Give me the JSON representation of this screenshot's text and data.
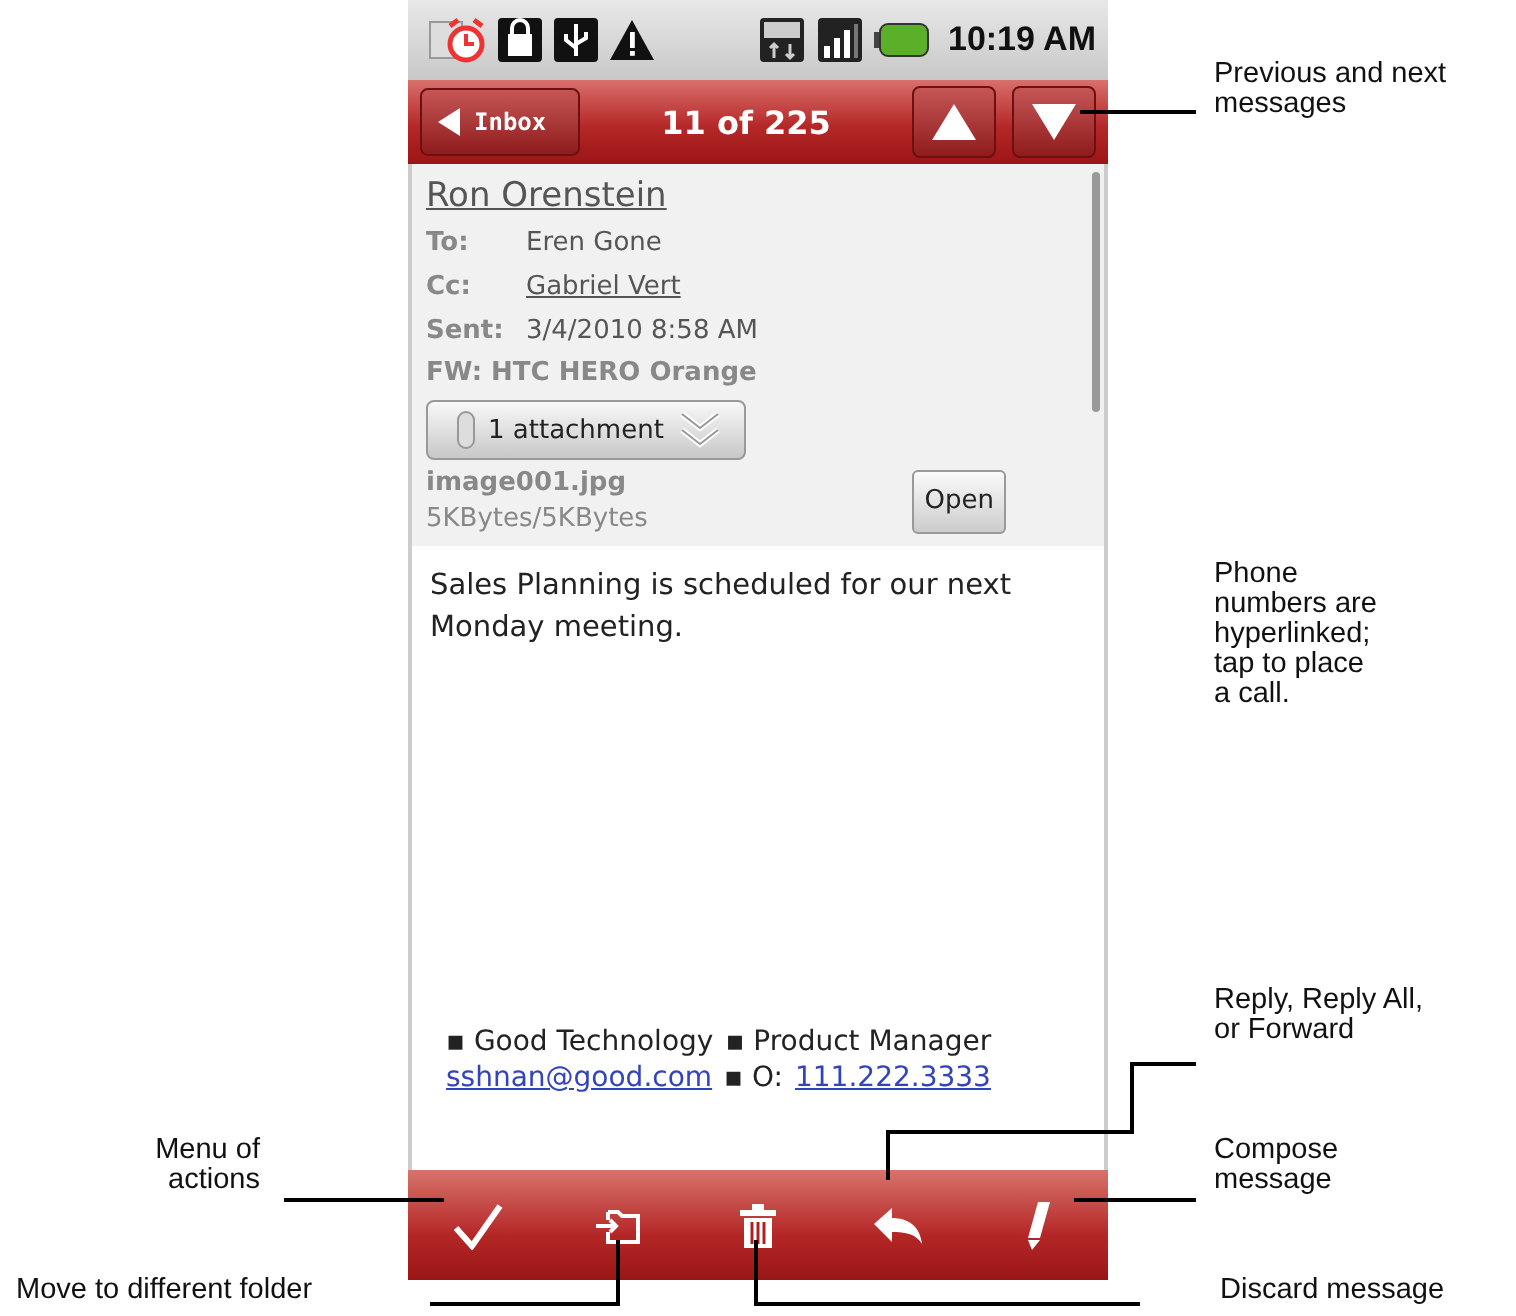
{
  "status_bar": {
    "time": "10:19 AM"
  },
  "title_bar": {
    "back_button": "Inbox",
    "position": "11 of 225"
  },
  "header": {
    "sender": "Ron Orenstein",
    "fields": [
      {
        "label": "To:",
        "value": "Eren Gone",
        "link": false
      },
      {
        "label": "Cc:",
        "value": "Gabriel Vert",
        "link": true
      },
      {
        "label": "Sent:",
        "value": "3/4/2010 8:58 AM",
        "link": false
      }
    ],
    "subject": "FW: HTC HERO Orange",
    "attachment_button": "1 attachment",
    "attachment": {
      "name": "image001.jpg",
      "size": "5KBytes/5KBytes",
      "open_button": "Open"
    }
  },
  "body": {
    "text": "Sales Planning is scheduled for our next Monday meeting.",
    "signature": [
      [
        {
          "kind": "text",
          "text": "▪ Good Technology"
        },
        {
          "kind": "text",
          "text": "▪ Product Manager"
        }
      ],
      [
        {
          "kind": "link",
          "text": "sshnan@good.com"
        },
        {
          "kind": "text",
          "text": "▪ O:"
        },
        {
          "kind": "link",
          "text": "111.222.3333"
        }
      ]
    ]
  },
  "callouts": [
    {
      "text": "Previous and next messages"
    },
    {
      "text": "Phone numbers are hyperlinked; tap to place a call."
    },
    {
      "text": "Reply, Reply All, or Forward"
    },
    {
      "text": "Compose message"
    },
    {
      "text": "Discard message"
    },
    {
      "text": "Menu of actions"
    },
    {
      "text": "Move to different folder"
    }
  ]
}
